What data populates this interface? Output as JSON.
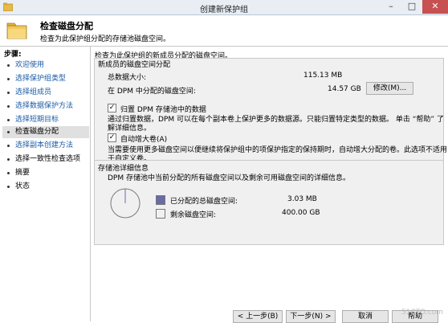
{
  "window": {
    "title": "创建新保护组"
  },
  "header": {
    "title": "检查磁盘分配",
    "subtitle": "检查为此保护组分配的存储池磁盘空间。"
  },
  "sidebar": {
    "steps_label": "步骤:",
    "items": [
      {
        "label": "欢迎使用"
      },
      {
        "label": "选择保护组类型"
      },
      {
        "label": "选择组成员"
      },
      {
        "label": "选择数据保护方法"
      },
      {
        "label": "选择短期目标"
      },
      {
        "label": "检查磁盘分配"
      },
      {
        "label": "选择副本创建方法"
      },
      {
        "label": "选择一致性检查选项"
      },
      {
        "label": "摘要"
      },
      {
        "label": "状态"
      }
    ]
  },
  "main": {
    "intro": "检查为此保护组的新成员分配的磁盘空间。",
    "new_members": {
      "group_label": "新成员的磁盘空间分配",
      "total_label": "总数据大小:",
      "total_value": "115.13 MB",
      "dpm_label": "在 DPM 中分配的磁盘空间:",
      "dpm_value": "14.57 GB",
      "modify_button": "修改(M)...",
      "colocate_label": "归置 DPM 存储池中的数据",
      "colocate_desc_1": "通过归置数据，DPM 可以在每个副本卷上保护更多的数据源。只能归置特定类型的数据。 单击 “帮助” 了",
      "colocate_desc_2": "解详细信息。",
      "autogrow_label": "自动增大卷(A)",
      "autogrow_desc_1": "当需要使用更多磁盘空间以便继续将保护组中的项保护指定的保持期时，自动增大分配的卷。此选项不适用",
      "autogrow_desc_2": "于自定义卷。"
    },
    "storage": {
      "group_label": "存储池详细信息",
      "desc": "DPM 存储池中当前分配的所有磁盘空间以及剩余可用磁盘空间的详细信息。",
      "allocated_label": "已分配的总磁盘空间:",
      "allocated_value": "3.03 MB",
      "remaining_label": "剩余磁盘空间:",
      "remaining_value": "400.00 GB",
      "allocated_fraction": 7.4e-06,
      "allocated_color": "#6a6aa8",
      "remaining_color": "#f0f0f0"
    }
  },
  "footer": {
    "back": "< 上一步(B)",
    "next": "下一步(N) >",
    "cancel": "取消",
    "help": "帮助"
  },
  "watermark": "51CTO.com"
}
